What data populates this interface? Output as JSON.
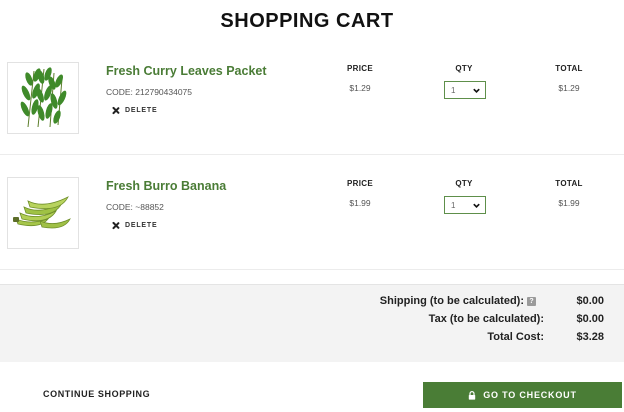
{
  "page": {
    "title": "SHOPPING CART"
  },
  "columns": {
    "price": "PRICE",
    "qty": "QTY",
    "total": "TOTAL"
  },
  "items": [
    {
      "name": "Fresh Curry Leaves Packet",
      "code": "CODE: 212790434075",
      "delete_label": "DELETE",
      "price": "$1.29",
      "qty": "1",
      "total": "$1.29",
      "image_icon": "curry-leaves-image"
    },
    {
      "name": "Fresh Burro Banana",
      "code": "CODE: ~88852",
      "delete_label": "DELETE",
      "price": "$1.99",
      "qty": "1",
      "total": "$1.99",
      "image_icon": "banana-image"
    }
  ],
  "summary": {
    "shipping_label": "Shipping (to be calculated):",
    "shipping_value": "$0.00",
    "tax_label": "Tax (to be calculated):",
    "tax_value": "$0.00",
    "total_label": "Total Cost:",
    "total_value": "$3.28"
  },
  "actions": {
    "continue_label": "CONTINUE SHOPPING",
    "checkout_label": "GO TO CHECKOUT"
  },
  "colors": {
    "brand_green": "#4a7d36",
    "product_name_green": "#4a7c36",
    "summary_bg": "#f3f3f3"
  }
}
